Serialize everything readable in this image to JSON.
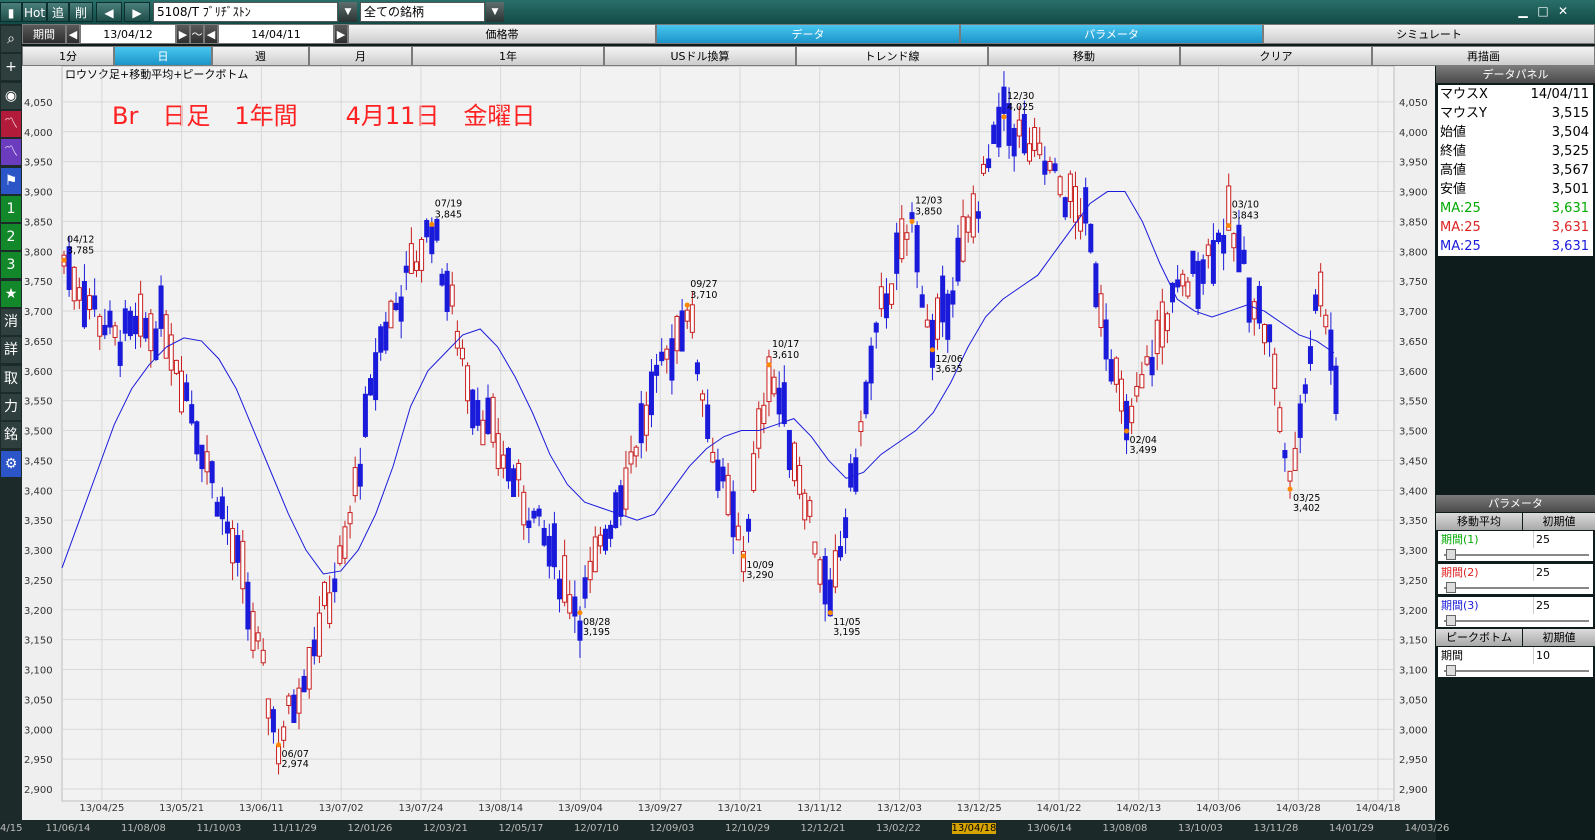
{
  "toolbar": {
    "hot": "Hot",
    "add": "追",
    "del": "削",
    "prev": "◀",
    "next": "▶",
    "stock": "5108/T ﾌﾞﾘﾁﾞｽﾄﾝ",
    "group": "全ての銘柄",
    "min": "▁",
    "max": "□",
    "close": "✕"
  },
  "period": {
    "label": "期間",
    "from": "13/04/12",
    "tilde": "～",
    "to": "14/04/11"
  },
  "tabs_top": [
    "価格帯",
    "データ",
    "パラメータ",
    "シミュレート"
  ],
  "tabs_range": [
    "1分",
    "日",
    "週",
    "月",
    "1年",
    "USドル換算",
    "トレンド線",
    "移動",
    "クリア",
    "再描画"
  ],
  "sidebar": [
    "⌕",
    "+",
    "◉",
    "〽",
    "〽",
    "⚑",
    "1",
    "2",
    "3",
    "★",
    "消",
    "詳",
    "取",
    "力",
    "銘",
    "⚙"
  ],
  "chart": {
    "subtitle": "ロウソク足+移動平均+ピークボトム",
    "title": "Br　日足　1年間　　4月11日　金曜日"
  },
  "chart_data": {
    "type": "candlestick",
    "title": "Br　日足　1年間　　4月11日　金曜日",
    "ylim": [
      2880,
      4080
    ],
    "yticks": [
      4050,
      4000,
      3950,
      3900,
      3850,
      3800,
      3750,
      3700,
      3650,
      3600,
      3550,
      3500,
      3450,
      3400,
      3350,
      3300,
      3250,
      3200,
      3150,
      3100,
      3050,
      3000,
      2950,
      2900
    ],
    "ytick_labels": [
      "4,050",
      "4,000",
      "3,950",
      "3,900",
      "3,850",
      "3,800",
      "3,750",
      "3,700",
      "3,650",
      "3,600",
      "3,550",
      "3,500",
      "3,450",
      "3,400",
      "3,350",
      "3,300",
      "3,250",
      "3,200",
      "3,150",
      "3,100",
      "3,050",
      "3,000",
      "2,950",
      "2,900"
    ],
    "xtick_labels": [
      "13/04/25",
      "13/05/21",
      "13/06/11",
      "13/07/02",
      "13/07/24",
      "13/08/14",
      "13/09/04",
      "13/09/27",
      "13/10/21",
      "13/11/12",
      "13/12/03",
      "13/12/25",
      "14/01/22",
      "14/02/13",
      "14/03/06",
      "14/03/28",
      "14/04/18"
    ],
    "peaks": [
      {
        "date": "04/12",
        "value": "3,785",
        "y": 3785
      },
      {
        "date": "07/19",
        "value": "3,845",
        "y": 3845
      },
      {
        "date": "09/27",
        "value": "3,710",
        "y": 3710
      },
      {
        "date": "10/17",
        "value": "3,610",
        "y": 3610
      },
      {
        "date": "12/03",
        "value": "3,850",
        "y": 3850
      },
      {
        "date": "12/30",
        "value": "4,025",
        "y": 4025
      },
      {
        "date": "03/10",
        "value": "3,843",
        "y": 3843
      }
    ],
    "bottoms": [
      {
        "date": "06/07",
        "value": "2,974",
        "y": 2974
      },
      {
        "date": "08/28",
        "value": "3,195",
        "y": 3195
      },
      {
        "date": "10/09",
        "value": "3,290",
        "y": 3290
      },
      {
        "date": "11/05",
        "value": "3,195",
        "y": 3195
      },
      {
        "date": "12/06",
        "value": "3,635",
        "y": 3635
      },
      {
        "date": "02/04",
        "value": "3,499",
        "y": 3499
      },
      {
        "date": "03/25",
        "value": "3,402",
        "y": 3402
      }
    ],
    "ma25": [
      3270,
      3350,
      3430,
      3510,
      3570,
      3610,
      3640,
      3655,
      3650,
      3620,
      3570,
      3500,
      3430,
      3360,
      3300,
      3260,
      3265,
      3300,
      3360,
      3440,
      3540,
      3600,
      3630,
      3660,
      3670,
      3640,
      3590,
      3530,
      3460,
      3410,
      3380,
      3370,
      3360,
      3350,
      3360,
      3400,
      3440,
      3470,
      3490,
      3500,
      3500,
      3510,
      3520,
      3490,
      3450,
      3420,
      3430,
      3460,
      3480,
      3500,
      3530,
      3580,
      3640,
      3690,
      3720,
      3740,
      3760,
      3800,
      3840,
      3880,
      3900,
      3900,
      3850,
      3780,
      3720,
      3700,
      3690,
      3700,
      3710,
      3700,
      3680,
      3660,
      3650,
      3630
    ],
    "colors": {
      "up": "#dd2222",
      "down": "#1a1adb",
      "ma": "#1a1adb",
      "peak": "#ff8800"
    }
  },
  "data_panel": {
    "title": "データパネル",
    "rows": [
      {
        "label": "マウスX",
        "value": "14/04/11"
      },
      {
        "label": "マウスY",
        "value": "3,515"
      },
      {
        "label": "始値",
        "value": "3,504"
      },
      {
        "label": "終値",
        "value": "3,525"
      },
      {
        "label": "高値",
        "value": "3,567"
      },
      {
        "label": "安値",
        "value": "3,501"
      },
      {
        "label": "MA:25",
        "value": "3,631",
        "color": "#00aa00"
      },
      {
        "label": "MA:25",
        "value": "3,631",
        "color": "#dd2222"
      },
      {
        "label": "MA:25",
        "value": "3,631",
        "color": "#1a1adb"
      }
    ]
  },
  "param_panel": {
    "title": "パラメータ",
    "ma_header": "移動平均",
    "init": "初期値",
    "periods": [
      {
        "label": "期間(1)",
        "value": "25",
        "color": "#00aa00"
      },
      {
        "label": "期間(2)",
        "value": "25",
        "color": "#dd2222"
      },
      {
        "label": "期間(3)",
        "value": "25",
        "color": "#1a1adb"
      }
    ],
    "pb_header": "ピークボトム",
    "pb_init": "初期値",
    "pb_period": {
      "label": "期間",
      "value": "10"
    }
  },
  "datebar": [
    "4/15",
    "11/06/14",
    "11/08/08",
    "11/10/03",
    "11/11/29",
    "12/01/26",
    "12/03/21",
    "12/05/17",
    "12/07/10",
    "12/09/03",
    "12/10/29",
    "12/12/21",
    "13/02/22",
    "13/04/18",
    "13/06/14",
    "13/08/08",
    "13/10/03",
    "13/11/28",
    "14/01/29",
    "14/03/26"
  ]
}
